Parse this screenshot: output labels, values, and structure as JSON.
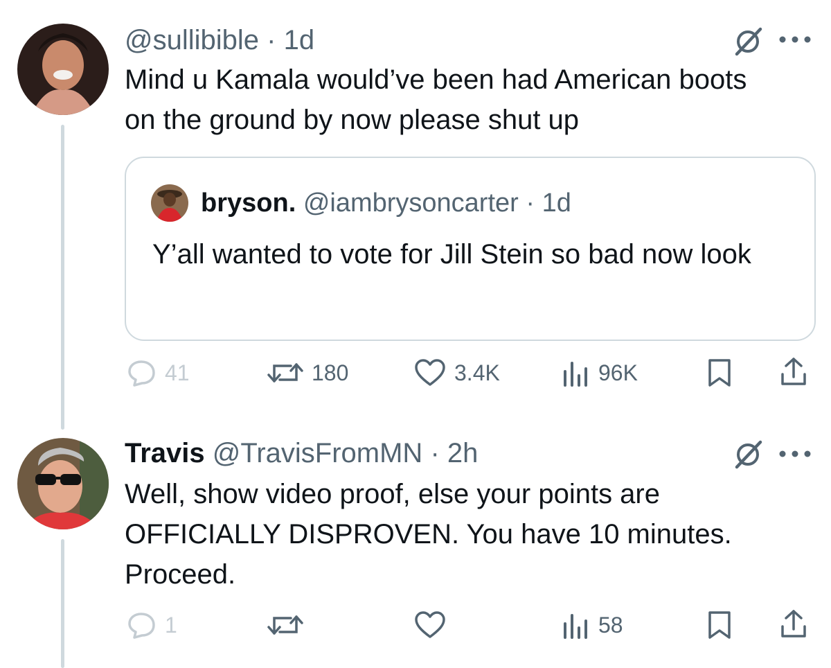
{
  "tweets": [
    {
      "handle": "@sullibible",
      "sep": "·",
      "time": "1d",
      "text": "Mind u Kamala would’ve been had American boots on the ground by now please shut up",
      "quote": {
        "name": "bryson.",
        "handle": "@iambrysoncarter",
        "sep": "·",
        "time": "1d",
        "text": "Y’all wanted to vote for Jill Stein so bad now look"
      },
      "actions": {
        "replies": "41",
        "reposts": "180",
        "likes": "3.4K",
        "views": "96K"
      }
    },
    {
      "name": "Travis",
      "handle": "@TravisFromMN",
      "sep": "·",
      "time": "2h",
      "text": "Well, show video proof, else your points are OFFICIALLY DISPROVEN. You have 10 minutes. Proceed.",
      "actions": {
        "replies": "1",
        "views": "58"
      }
    }
  ],
  "colors": {
    "muted": "#536471",
    "faded": "#c4ccd2",
    "border": "#cfd9de",
    "text": "#0f1419"
  },
  "icons": [
    "grok-icon",
    "more-icon",
    "reply-icon",
    "repost-icon",
    "like-icon",
    "views-icon",
    "bookmark-icon",
    "share-icon"
  ]
}
